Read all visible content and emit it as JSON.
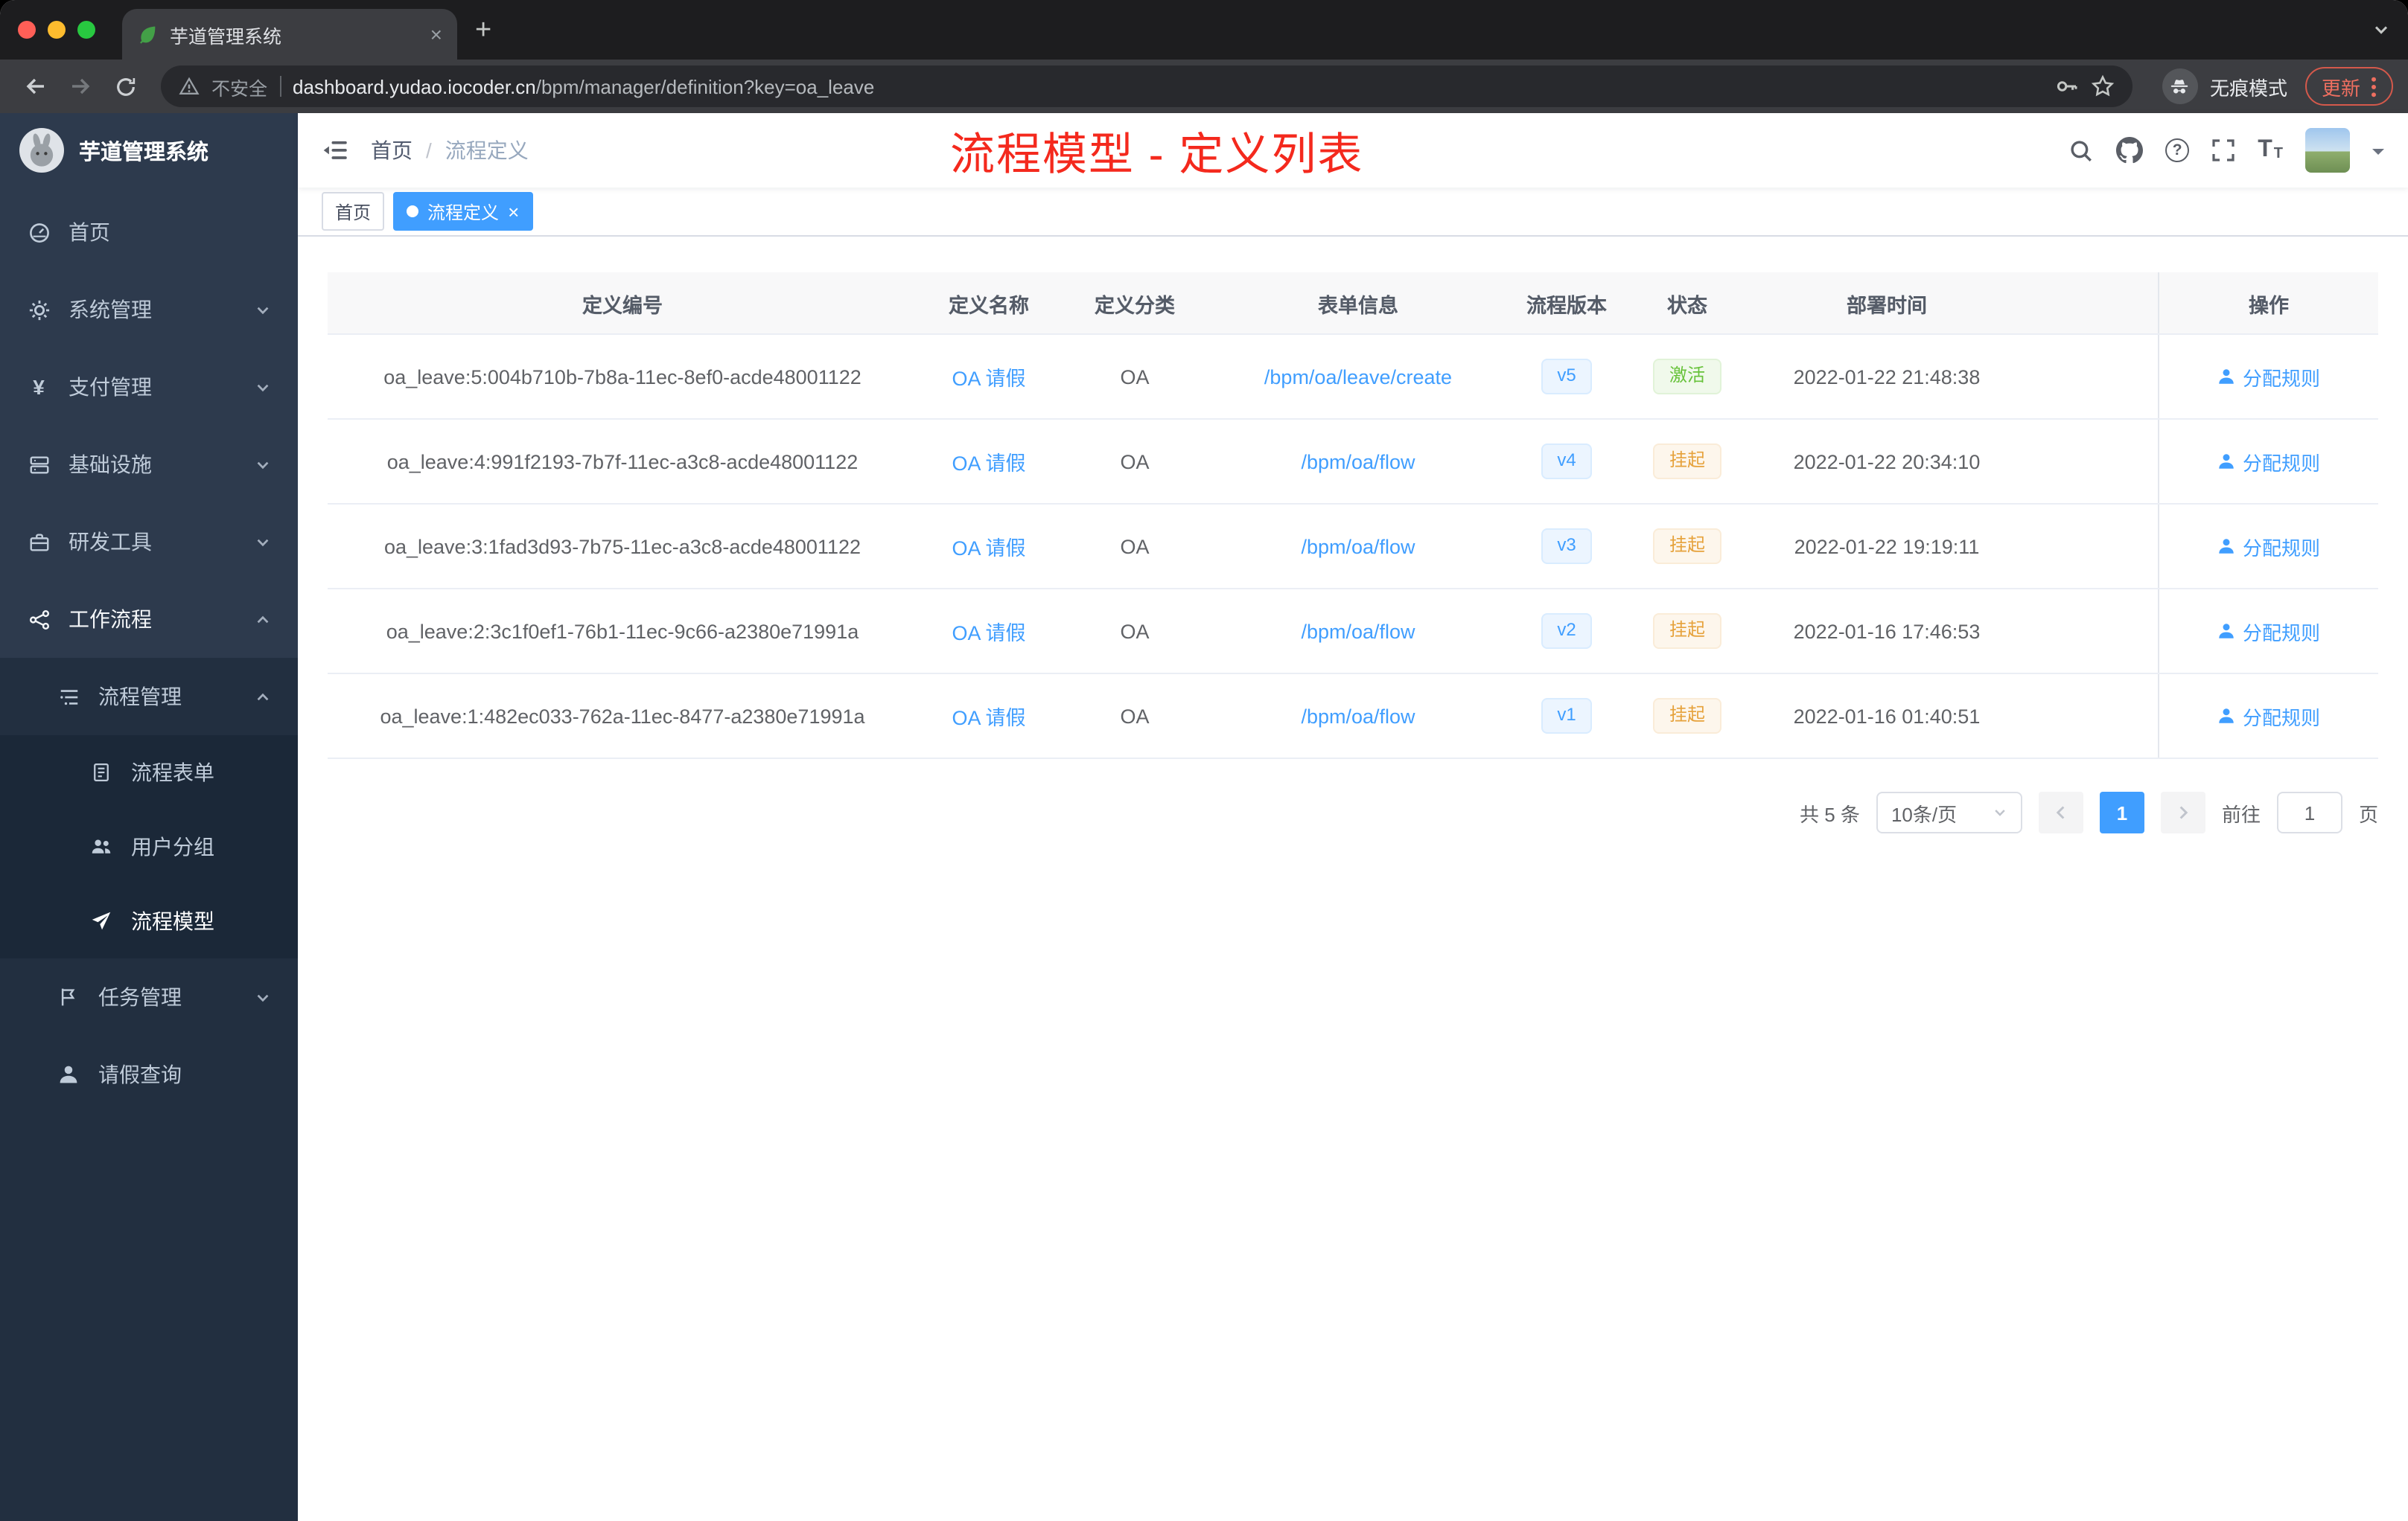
{
  "colors": {
    "accent": "#409eff",
    "success": "#67c23a",
    "warning": "#e6a23c",
    "annotation_red": "#f4291d",
    "sidebar_bg": "#2d3a4d"
  },
  "browser": {
    "tab_title": "芋道管理系统",
    "security_label": "不安全",
    "url_domain": "dashboard.yudao.iocoder.cn",
    "url_path": "/bpm/manager/definition?key=oa_leave",
    "incognito_label": "无痕模式",
    "update_label": "更新"
  },
  "sidebar": {
    "logo_title": "芋道管理系统",
    "items": [
      "首页",
      "系统管理",
      "支付管理",
      "基础设施",
      "研发工具",
      "工作流程"
    ],
    "sub_items": [
      "流程管理",
      "流程表单",
      "用户分组",
      "流程模型",
      "任务管理",
      "请假查询"
    ]
  },
  "header": {
    "breadcrumb_home": "首页",
    "breadcrumb_sep": "/",
    "breadcrumb_current": "流程定义",
    "annotation": "流程模型 - 定义列表"
  },
  "tags": [
    {
      "label": "首页"
    },
    {
      "label": "流程定义"
    }
  ],
  "table": {
    "columns": [
      "定义编号",
      "定义名称",
      "定义分类",
      "表单信息",
      "流程版本",
      "状态",
      "部署时间",
      "操作"
    ],
    "rows": [
      {
        "id": "oa_leave:5:004b710b-7b8a-11ec-8ef0-acde48001122",
        "name": "OA 请假",
        "category": "OA",
        "form": "/bpm/oa/leave/create",
        "version": "v5",
        "status": "激活",
        "status_variant": "success",
        "time": "2022-01-22 21:48:38",
        "action": "分配规则"
      },
      {
        "id": "oa_leave:4:991f2193-7b7f-11ec-a3c8-acde48001122",
        "name": "OA 请假",
        "category": "OA",
        "form": "/bpm/oa/flow",
        "version": "v4",
        "status": "挂起",
        "status_variant": "warning",
        "time": "2022-01-22 20:34:10",
        "action": "分配规则"
      },
      {
        "id": "oa_leave:3:1fad3d93-7b75-11ec-a3c8-acde48001122",
        "name": "OA 请假",
        "category": "OA",
        "form": "/bpm/oa/flow",
        "version": "v3",
        "status": "挂起",
        "status_variant": "warning",
        "time": "2022-01-22 19:19:11",
        "action": "分配规则"
      },
      {
        "id": "oa_leave:2:3c1f0ef1-76b1-11ec-9c66-a2380e71991a",
        "name": "OA 请假",
        "category": "OA",
        "form": "/bpm/oa/flow",
        "version": "v2",
        "status": "挂起",
        "status_variant": "warning",
        "time": "2022-01-16 17:46:53",
        "action": "分配规则"
      },
      {
        "id": "oa_leave:1:482ec033-762a-11ec-8477-a2380e71991a",
        "name": "OA 请假",
        "category": "OA",
        "form": "/bpm/oa/flow",
        "version": "v1",
        "status": "挂起",
        "status_variant": "warning",
        "time": "2022-01-16 01:40:51",
        "action": "分配规则"
      }
    ]
  },
  "pagination": {
    "total": "共 5 条",
    "page_size": "10条/页",
    "current_page": "1",
    "goto_label": "前往",
    "goto_value": "1",
    "unit_label": "页"
  },
  "icons": {
    "tab_favicon": "leaf-icon",
    "toolbar": [
      "back-icon",
      "forward-icon",
      "reload-icon",
      "warning-icon",
      "key-icon",
      "star-icon",
      "incognito-icon",
      "kebab-menu-icon"
    ],
    "navbar": [
      "hamburger-icon",
      "search-icon",
      "github-icon",
      "help-icon",
      "fullscreen-icon",
      "font-size-icon"
    ],
    "sidebar": [
      "dashboard-icon",
      "gear-icon",
      "yen-icon",
      "server-icon",
      "briefcase-icon",
      "share-nodes-icon",
      "list-tree-icon",
      "document-icon",
      "user-group-icon",
      "paper-plane-icon",
      "flag-icon",
      "person-icon"
    ]
  }
}
